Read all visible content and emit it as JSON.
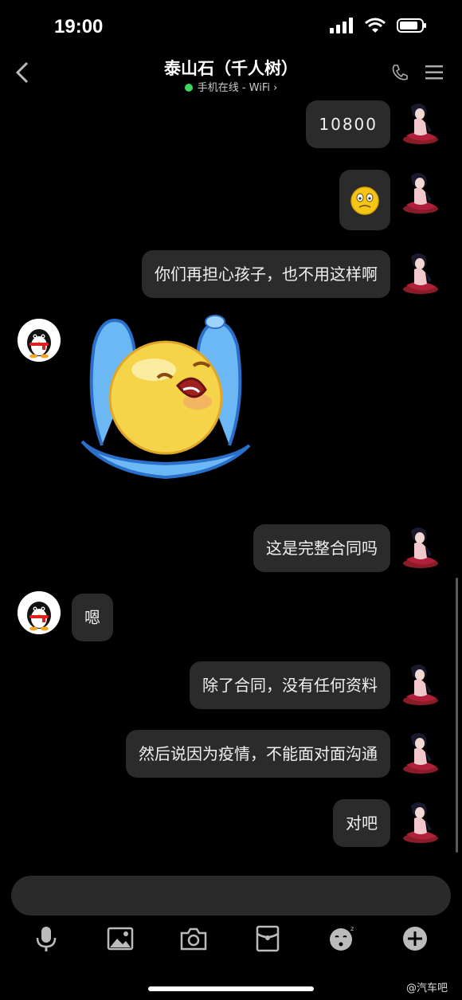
{
  "status_bar": {
    "time": "19:00"
  },
  "header": {
    "title": "泰山石（千人树）",
    "subtitle": "手机在线 - WiFi",
    "subtitle_chevron": "›"
  },
  "messages": [
    {
      "side": "right",
      "type": "text",
      "text": "10800"
    },
    {
      "side": "right",
      "type": "emoji",
      "icon": "nervous-face-emoji"
    },
    {
      "side": "right",
      "type": "text",
      "text": "你们再担心孩子，也不用这样啊"
    },
    {
      "side": "left",
      "type": "sticker",
      "icon": "crying-face-sticker"
    },
    {
      "side": "right",
      "type": "text",
      "text": "这是完整合同吗"
    },
    {
      "side": "left",
      "type": "text",
      "text": "嗯"
    },
    {
      "side": "right",
      "type": "text",
      "text": "除了合同，没有任何资料"
    },
    {
      "side": "right",
      "type": "text",
      "text": "然后说因为疫情，不能面对面沟通"
    },
    {
      "side": "right",
      "type": "text",
      "text": "对吧"
    }
  ],
  "toolbar": [
    "microphone-icon",
    "image-icon",
    "camera-icon",
    "red-packet-icon",
    "sticker-icon",
    "plus-icon"
  ],
  "watermark": "@汽车吧",
  "colors": {
    "background": "#000000",
    "bubble": "#2b2b2b",
    "online": "#3fd65f"
  }
}
